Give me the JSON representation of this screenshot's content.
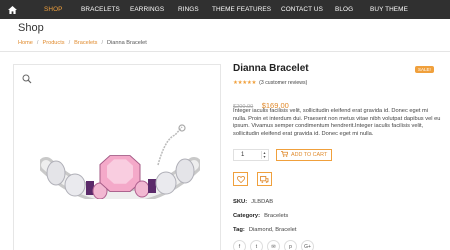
{
  "nav": {
    "items": [
      "SHOP",
      "BRACELETS",
      "EARRINGS",
      "RINGS",
      "THEME FEATURES",
      "CONTACT US",
      "BLOG",
      "BUY THEME"
    ],
    "active": "SHOP",
    "home_icon": "home-icon"
  },
  "page": {
    "title": "Shop"
  },
  "breadcrumb": {
    "home": "Home",
    "products": "Products",
    "bracelets": "Bracelets",
    "current": "Dianna Bracelet"
  },
  "product": {
    "title": "Dianna Bracelet",
    "sale_badge": "SALE!",
    "stars": "★★★★★",
    "reviews": "(3 customer reviews)",
    "old_price": "$200.00",
    "price": "$169.00",
    "description": "Integer iaculis facilisis velit, sollicitudin eleifend erat gravida id. Donec eget mi nulla. Proin et interdum dui. Praesent non metus vitae nibh volutpat dapibus vel eu ipsum. Vivamus semper condimentum hendrerit.Integer iaculis facilisis velit, sollicitudin eleifend erat gravida id. Donec eget mi nulla.",
    "quantity": "1",
    "add_to_cart": "ADD TO CART",
    "sku_label": "SKU:",
    "sku": "JLBDAB",
    "category_label": "Category:",
    "category": "Bracelets",
    "tag_label": "Tag:",
    "tags": "Diamond, Bracelet"
  },
  "social": [
    "f",
    "t",
    "✉",
    "p",
    "G+"
  ],
  "colors": {
    "accent": "#f0a03c",
    "nav_bg": "#303030"
  }
}
